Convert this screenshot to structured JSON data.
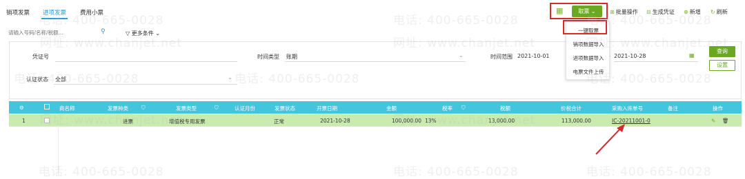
{
  "tabs": [
    {
      "label": "销项发票"
    },
    {
      "label": "进项发票"
    },
    {
      "label": "费用小票"
    }
  ],
  "toolbar": {
    "take_label": "取票",
    "batch_label": "批量操作",
    "voucher_label": "生成凭证",
    "new_label": "新增",
    "refresh_label": "刷新"
  },
  "take_menu": {
    "items": [
      "一键取票",
      "销项数据导入",
      "进项数据导入",
      "电票文件上传"
    ]
  },
  "search": {
    "placeholder": "请输入号码/名称/税额...",
    "more_label": "更多条件"
  },
  "filters": {
    "voucher_no_label": "凭证号",
    "voucher_no_value": "",
    "time_type_label": "时间类型",
    "time_type_value": "账期",
    "time_range_label": "时间范围",
    "date_from": "2021-10-01",
    "date_sep": "-",
    "date_to": "2021-10-28",
    "cert_status_label": "认证状态",
    "cert_status_value": "全部",
    "query_label": "查询",
    "settings_label": "设置"
  },
  "table": {
    "headers": [
      "商名称",
      "发票种类",
      "发票类型",
      "认证月份",
      "发票状态",
      "开票日期",
      "金额",
      "税率",
      "税额",
      "价税合计",
      "采购入库单号",
      "备注",
      "操作"
    ],
    "rows": [
      {
        "index": "1",
        "name": "",
        "kind": "进票",
        "type": "增值税专用发票",
        "cert_month": "",
        "status": "正常",
        "date": "2021-10-28",
        "amount": "100,000.00",
        "rate": "13%",
        "tax": "13,000.00",
        "total": "113,000.00",
        "purchase_no": "IC-20211001-0",
        "remark": ""
      }
    ]
  },
  "watermark": {
    "phone": "电话: 400-665-0028",
    "site": "网址: www.chanjet.net"
  },
  "colors": {
    "accent_blue": "#1e9be0",
    "header_teal": "#43c5e0",
    "brand_green": "#6aa822",
    "row_green": "#c9ebb0",
    "highlight_red": "#d9272e"
  }
}
